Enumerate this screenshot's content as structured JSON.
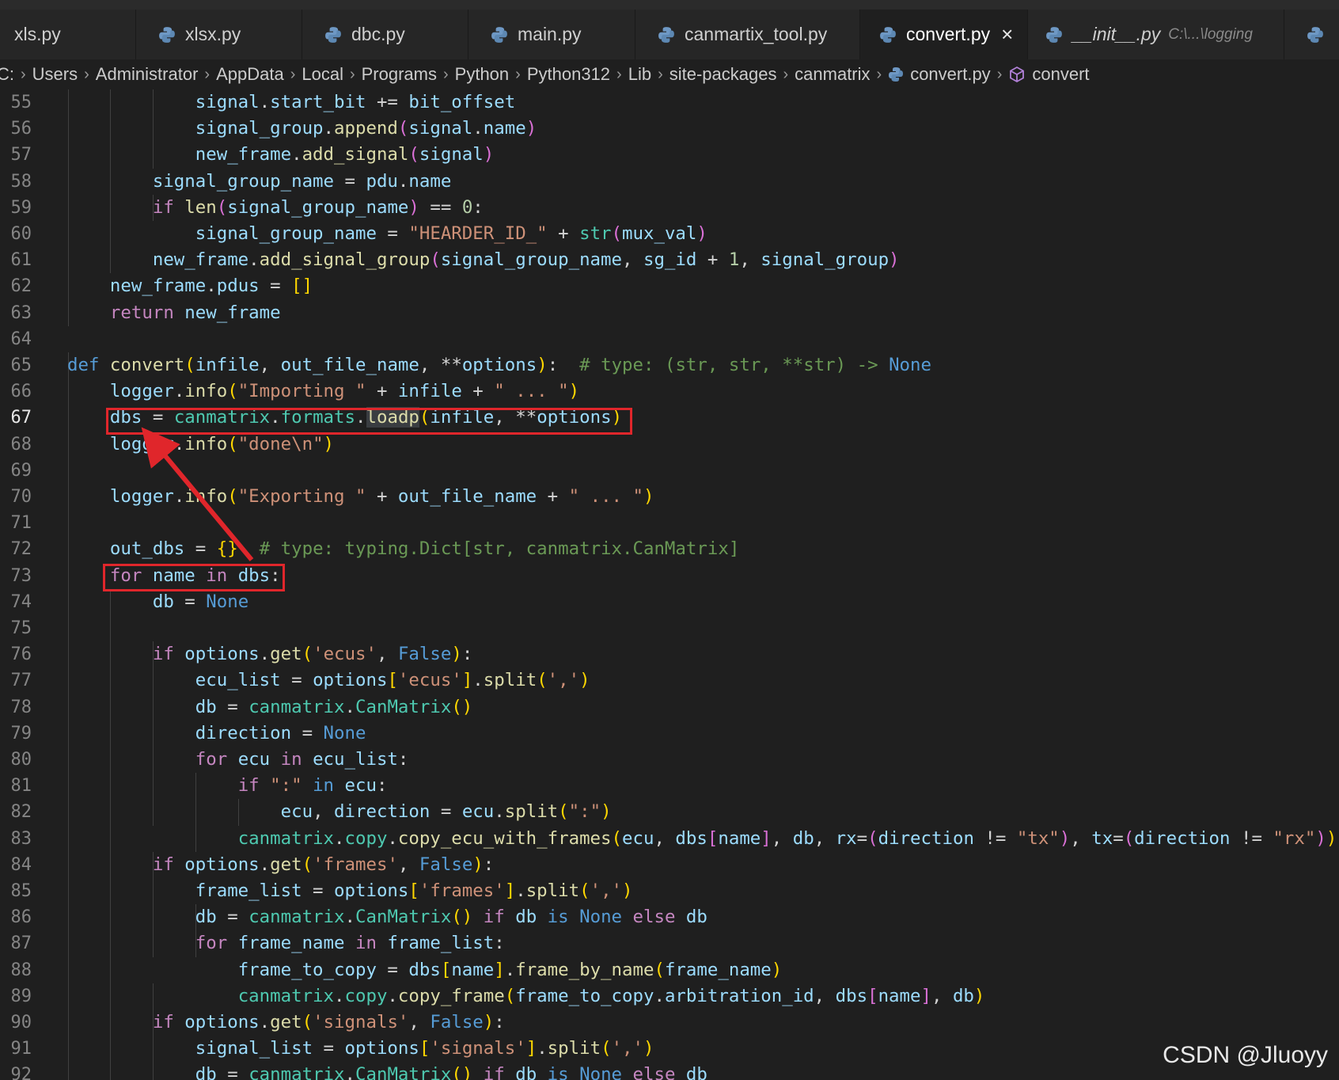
{
  "tabs": [
    {
      "label": "xls.py"
    },
    {
      "label": "xlsx.py"
    },
    {
      "label": "dbc.py"
    },
    {
      "label": "main.py"
    },
    {
      "label": "canmartix_tool.py"
    },
    {
      "label": "convert.py",
      "close": "×"
    },
    {
      "label": "__init__.py",
      "description": "C:\\...\\logging"
    }
  ],
  "breadcrumb": [
    "C:",
    "Users",
    "Administrator",
    "AppData",
    "Local",
    "Programs",
    "Python",
    "Python312",
    "Lib",
    "site-packages",
    "canmatrix",
    "convert.py",
    "convert"
  ],
  "line_numbers": [
    "55",
    "56",
    "57",
    "58",
    "59",
    "60",
    "61",
    "62",
    "63",
    "64",
    "65",
    "66",
    "67",
    "68",
    "69",
    "70",
    "71",
    "72",
    "73",
    "74",
    "75",
    "76",
    "77",
    "78",
    "79",
    "80",
    "81",
    "82",
    "83",
    "84",
    "85",
    "86",
    "87",
    "88",
    "89",
    "90",
    "91",
    "92"
  ],
  "current_line": "67",
  "code_lines": [
    [
      [
        "            ",
        "op"
      ],
      [
        "signal",
        "var"
      ],
      [
        ".",
        "op"
      ],
      [
        "start_bit",
        "var"
      ],
      [
        " += ",
        "op"
      ],
      [
        "bit_offset",
        "var"
      ]
    ],
    [
      [
        "            ",
        "op"
      ],
      [
        "signal_group",
        "var"
      ],
      [
        ".",
        "op"
      ],
      [
        "append",
        "fn"
      ],
      [
        "(",
        "br2"
      ],
      [
        "signal",
        "var"
      ],
      [
        ".",
        "op"
      ],
      [
        "name",
        "var"
      ],
      [
        ")",
        "br2"
      ]
    ],
    [
      [
        "            ",
        "op"
      ],
      [
        "new_frame",
        "var"
      ],
      [
        ".",
        "op"
      ],
      [
        "add_signal",
        "fn"
      ],
      [
        "(",
        "br2"
      ],
      [
        "signal",
        "var"
      ],
      [
        ")",
        "br2"
      ]
    ],
    [
      [
        "        ",
        "op"
      ],
      [
        "signal_group_name",
        "var"
      ],
      [
        " = ",
        "op"
      ],
      [
        "pdu",
        "var"
      ],
      [
        ".",
        "op"
      ],
      [
        "name",
        "var"
      ]
    ],
    [
      [
        "        ",
        "op"
      ],
      [
        "if ",
        "kw"
      ],
      [
        "len",
        "fn"
      ],
      [
        "(",
        "br2"
      ],
      [
        "signal_group_name",
        "var"
      ],
      [
        ")",
        "br2"
      ],
      [
        " == ",
        "op"
      ],
      [
        "0",
        "num"
      ],
      [
        ":",
        "op"
      ]
    ],
    [
      [
        "            ",
        "op"
      ],
      [
        "signal_group_name",
        "var"
      ],
      [
        " = ",
        "op"
      ],
      [
        "\"HEARDER_ID_\"",
        "str"
      ],
      [
        " + ",
        "op"
      ],
      [
        "str",
        "cls"
      ],
      [
        "(",
        "br2"
      ],
      [
        "mux_val",
        "var"
      ],
      [
        ")",
        "br2"
      ]
    ],
    [
      [
        "        ",
        "op"
      ],
      [
        "new_frame",
        "var"
      ],
      [
        ".",
        "op"
      ],
      [
        "add_signal_group",
        "fn"
      ],
      [
        "(",
        "br2"
      ],
      [
        "signal_group_name",
        "var"
      ],
      [
        ", ",
        "op"
      ],
      [
        "sg_id",
        "var"
      ],
      [
        " + ",
        "op"
      ],
      [
        "1",
        "num"
      ],
      [
        ", ",
        "op"
      ],
      [
        "signal_group",
        "var"
      ],
      [
        ")",
        "br2"
      ]
    ],
    [
      [
        "    ",
        "op"
      ],
      [
        "new_frame",
        "var"
      ],
      [
        ".",
        "op"
      ],
      [
        "pdus",
        "var"
      ],
      [
        " = ",
        "op"
      ],
      [
        "[]",
        "br1"
      ]
    ],
    [
      [
        "    ",
        "op"
      ],
      [
        "return ",
        "kw"
      ],
      [
        "new_frame",
        "var"
      ]
    ],
    [],
    [
      [
        "def ",
        "def"
      ],
      [
        "convert",
        "fn"
      ],
      [
        "(",
        "br1"
      ],
      [
        "infile",
        "var"
      ],
      [
        ", ",
        "op"
      ],
      [
        "out_file_name",
        "var"
      ],
      [
        ", ",
        "op"
      ],
      [
        "**",
        "op"
      ],
      [
        "options",
        "var"
      ],
      [
        ")",
        "br1"
      ],
      [
        ":",
        "op"
      ],
      [
        "  # type: (str, str, **str) -> ",
        "com"
      ],
      [
        "None",
        "const"
      ]
    ],
    [
      [
        "    ",
        "op"
      ],
      [
        "logger",
        "var"
      ],
      [
        ".",
        "op"
      ],
      [
        "info",
        "fn"
      ],
      [
        "(",
        "br1"
      ],
      [
        "\"Importing \"",
        "str"
      ],
      [
        " + ",
        "op"
      ],
      [
        "infile",
        "var"
      ],
      [
        " + ",
        "op"
      ],
      [
        "\" ... \"",
        "str"
      ],
      [
        ")",
        "br1"
      ]
    ],
    [
      [
        "    ",
        "op"
      ],
      [
        "dbs",
        "var"
      ],
      [
        " = ",
        "op"
      ],
      [
        "canmatrix",
        "cls"
      ],
      [
        ".",
        "op"
      ],
      [
        "formats",
        "cls"
      ],
      [
        ".",
        "op"
      ],
      [
        "loadp",
        "fnhl"
      ],
      [
        "(",
        "br1"
      ],
      [
        "infile",
        "var"
      ],
      [
        ", ",
        "op"
      ],
      [
        "**",
        "op"
      ],
      [
        "options",
        "var"
      ],
      [
        ")",
        "br1"
      ]
    ],
    [
      [
        "    ",
        "op"
      ],
      [
        "logger",
        "var"
      ],
      [
        ".",
        "op"
      ],
      [
        "info",
        "fn"
      ],
      [
        "(",
        "br1"
      ],
      [
        "\"done\\n\"",
        "str"
      ],
      [
        ")",
        "br1"
      ]
    ],
    [],
    [
      [
        "    ",
        "op"
      ],
      [
        "logger",
        "var"
      ],
      [
        ".",
        "op"
      ],
      [
        "info",
        "fn"
      ],
      [
        "(",
        "br1"
      ],
      [
        "\"Exporting \"",
        "str"
      ],
      [
        " + ",
        "op"
      ],
      [
        "out_file_name",
        "var"
      ],
      [
        " + ",
        "op"
      ],
      [
        "\" ... \"",
        "str"
      ],
      [
        ")",
        "br1"
      ]
    ],
    [],
    [
      [
        "    ",
        "op"
      ],
      [
        "out_dbs",
        "var"
      ],
      [
        " = ",
        "op"
      ],
      [
        "{}",
        "br1"
      ],
      [
        "  # type: typing.Dict[str, canmatrix.CanMatrix]",
        "com"
      ]
    ],
    [
      [
        "    ",
        "op"
      ],
      [
        "for ",
        "kw"
      ],
      [
        "name",
        "var"
      ],
      [
        " in ",
        "kw"
      ],
      [
        "dbs",
        "var"
      ],
      [
        ":",
        "op"
      ]
    ],
    [
      [
        "        ",
        "op"
      ],
      [
        "db",
        "var"
      ],
      [
        " = ",
        "op"
      ],
      [
        "None",
        "const"
      ]
    ],
    [],
    [
      [
        "        ",
        "op"
      ],
      [
        "if ",
        "kw"
      ],
      [
        "options",
        "var"
      ],
      [
        ".",
        "op"
      ],
      [
        "get",
        "fn"
      ],
      [
        "(",
        "br1"
      ],
      [
        "'ecus'",
        "str"
      ],
      [
        ", ",
        "op"
      ],
      [
        "False",
        "const"
      ],
      [
        ")",
        "br1"
      ],
      [
        ":",
        "op"
      ]
    ],
    [
      [
        "            ",
        "op"
      ],
      [
        "ecu_list",
        "var"
      ],
      [
        " = ",
        "op"
      ],
      [
        "options",
        "var"
      ],
      [
        "[",
        "br1"
      ],
      [
        "'ecus'",
        "str"
      ],
      [
        "]",
        "br1"
      ],
      [
        ".",
        "op"
      ],
      [
        "split",
        "fn"
      ],
      [
        "(",
        "br1"
      ],
      [
        "','",
        "str"
      ],
      [
        ")",
        "br1"
      ]
    ],
    [
      [
        "            ",
        "op"
      ],
      [
        "db",
        "var"
      ],
      [
        " = ",
        "op"
      ],
      [
        "canmatrix",
        "cls"
      ],
      [
        ".",
        "op"
      ],
      [
        "CanMatrix",
        "cls"
      ],
      [
        "()",
        "br1"
      ]
    ],
    [
      [
        "            ",
        "op"
      ],
      [
        "direction",
        "var"
      ],
      [
        " = ",
        "op"
      ],
      [
        "None",
        "const"
      ]
    ],
    [
      [
        "            ",
        "op"
      ],
      [
        "for ",
        "kw"
      ],
      [
        "ecu",
        "var"
      ],
      [
        " in ",
        "kw"
      ],
      [
        "ecu_list",
        "var"
      ],
      [
        ":",
        "op"
      ]
    ],
    [
      [
        "                ",
        "op"
      ],
      [
        "if ",
        "kw"
      ],
      [
        "\":\"",
        "str"
      ],
      [
        " in ",
        "def"
      ],
      [
        "ecu",
        "var"
      ],
      [
        ":",
        "op"
      ]
    ],
    [
      [
        "                    ",
        "op"
      ],
      [
        "ecu",
        "var"
      ],
      [
        ", ",
        "op"
      ],
      [
        "direction",
        "var"
      ],
      [
        " = ",
        "op"
      ],
      [
        "ecu",
        "var"
      ],
      [
        ".",
        "op"
      ],
      [
        "split",
        "fn"
      ],
      [
        "(",
        "br1"
      ],
      [
        "\":\"",
        "str"
      ],
      [
        ")",
        "br1"
      ]
    ],
    [
      [
        "                ",
        "op"
      ],
      [
        "canmatrix",
        "cls"
      ],
      [
        ".",
        "op"
      ],
      [
        "copy",
        "cls"
      ],
      [
        ".",
        "op"
      ],
      [
        "copy_ecu_with_frames",
        "fn"
      ],
      [
        "(",
        "br1"
      ],
      [
        "ecu",
        "var"
      ],
      [
        ", ",
        "op"
      ],
      [
        "dbs",
        "var"
      ],
      [
        "[",
        "br2"
      ],
      [
        "name",
        "var"
      ],
      [
        "]",
        "br2"
      ],
      [
        ", ",
        "op"
      ],
      [
        "db",
        "var"
      ],
      [
        ", ",
        "op"
      ],
      [
        "rx",
        "var"
      ],
      [
        "=",
        "op"
      ],
      [
        "(",
        "br2"
      ],
      [
        "direction",
        "var"
      ],
      [
        " != ",
        "op"
      ],
      [
        "\"tx\"",
        "str"
      ],
      [
        ")",
        "br2"
      ],
      [
        ", ",
        "op"
      ],
      [
        "tx",
        "var"
      ],
      [
        "=",
        "op"
      ],
      [
        "(",
        "br2"
      ],
      [
        "direction",
        "var"
      ],
      [
        " != ",
        "op"
      ],
      [
        "\"rx\"",
        "str"
      ],
      [
        ")",
        "br2"
      ],
      [
        ")",
        "br1"
      ]
    ],
    [
      [
        "        ",
        "op"
      ],
      [
        "if ",
        "kw"
      ],
      [
        "options",
        "var"
      ],
      [
        ".",
        "op"
      ],
      [
        "get",
        "fn"
      ],
      [
        "(",
        "br1"
      ],
      [
        "'frames'",
        "str"
      ],
      [
        ", ",
        "op"
      ],
      [
        "False",
        "const"
      ],
      [
        ")",
        "br1"
      ],
      [
        ":",
        "op"
      ]
    ],
    [
      [
        "            ",
        "op"
      ],
      [
        "frame_list",
        "var"
      ],
      [
        " = ",
        "op"
      ],
      [
        "options",
        "var"
      ],
      [
        "[",
        "br1"
      ],
      [
        "'frames'",
        "str"
      ],
      [
        "]",
        "br1"
      ],
      [
        ".",
        "op"
      ],
      [
        "split",
        "fn"
      ],
      [
        "(",
        "br1"
      ],
      [
        "','",
        "str"
      ],
      [
        ")",
        "br1"
      ]
    ],
    [
      [
        "            ",
        "op"
      ],
      [
        "db",
        "var"
      ],
      [
        " = ",
        "op"
      ],
      [
        "canmatrix",
        "cls"
      ],
      [
        ".",
        "op"
      ],
      [
        "CanMatrix",
        "cls"
      ],
      [
        "()",
        "br1"
      ],
      [
        " if ",
        "kw"
      ],
      [
        "db",
        "var"
      ],
      [
        " is ",
        "def"
      ],
      [
        "None",
        "const"
      ],
      [
        " else ",
        "kw"
      ],
      [
        "db",
        "var"
      ]
    ],
    [
      [
        "            ",
        "op"
      ],
      [
        "for ",
        "kw"
      ],
      [
        "frame_name",
        "var"
      ],
      [
        " in ",
        "kw"
      ],
      [
        "frame_list",
        "var"
      ],
      [
        ":",
        "op"
      ]
    ],
    [
      [
        "                ",
        "op"
      ],
      [
        "frame_to_copy",
        "var"
      ],
      [
        " = ",
        "op"
      ],
      [
        "dbs",
        "var"
      ],
      [
        "[",
        "br1"
      ],
      [
        "name",
        "var"
      ],
      [
        "]",
        "br1"
      ],
      [
        ".",
        "op"
      ],
      [
        "frame_by_name",
        "fn"
      ],
      [
        "(",
        "br1"
      ],
      [
        "frame_name",
        "var"
      ],
      [
        ")",
        "br1"
      ]
    ],
    [
      [
        "                ",
        "op"
      ],
      [
        "canmatrix",
        "cls"
      ],
      [
        ".",
        "op"
      ],
      [
        "copy",
        "cls"
      ],
      [
        ".",
        "op"
      ],
      [
        "copy_frame",
        "fn"
      ],
      [
        "(",
        "br1"
      ],
      [
        "frame_to_copy",
        "var"
      ],
      [
        ".",
        "op"
      ],
      [
        "arbitration_id",
        "var"
      ],
      [
        ", ",
        "op"
      ],
      [
        "dbs",
        "var"
      ],
      [
        "[",
        "br2"
      ],
      [
        "name",
        "var"
      ],
      [
        "]",
        "br2"
      ],
      [
        ", ",
        "op"
      ],
      [
        "db",
        "var"
      ],
      [
        ")",
        "br1"
      ]
    ],
    [
      [
        "        ",
        "op"
      ],
      [
        "if ",
        "kw"
      ],
      [
        "options",
        "var"
      ],
      [
        ".",
        "op"
      ],
      [
        "get",
        "fn"
      ],
      [
        "(",
        "br1"
      ],
      [
        "'signals'",
        "str"
      ],
      [
        ", ",
        "op"
      ],
      [
        "False",
        "const"
      ],
      [
        ")",
        "br1"
      ],
      [
        ":",
        "op"
      ]
    ],
    [
      [
        "            ",
        "op"
      ],
      [
        "signal_list",
        "var"
      ],
      [
        " = ",
        "op"
      ],
      [
        "options",
        "var"
      ],
      [
        "[",
        "br1"
      ],
      [
        "'signals'",
        "str"
      ],
      [
        "]",
        "br1"
      ],
      [
        ".",
        "op"
      ],
      [
        "split",
        "fn"
      ],
      [
        "(",
        "br1"
      ],
      [
        "','",
        "str"
      ],
      [
        ")",
        "br1"
      ]
    ],
    [
      [
        "            ",
        "op"
      ],
      [
        "db",
        "var"
      ],
      [
        " = ",
        "op"
      ],
      [
        "canmatrix",
        "cls"
      ],
      [
        ".",
        "op"
      ],
      [
        "CanMatrix",
        "cls"
      ],
      [
        "()",
        "br1"
      ],
      [
        " if ",
        "kw"
      ],
      [
        "db",
        "var"
      ],
      [
        " is ",
        "def"
      ],
      [
        "None",
        "const"
      ],
      [
        " else ",
        "kw"
      ],
      [
        "db",
        "var"
      ]
    ]
  ],
  "watermark": "CSDN @Jluoyy",
  "colors": {
    "editor_bg": "#1f1f1f",
    "annotation_red": "#e0262b",
    "keyword": "#c586c0",
    "function": "#dcdcaa",
    "variable": "#9cdcfe",
    "string": "#ce9178",
    "comment": "#6a9955"
  }
}
